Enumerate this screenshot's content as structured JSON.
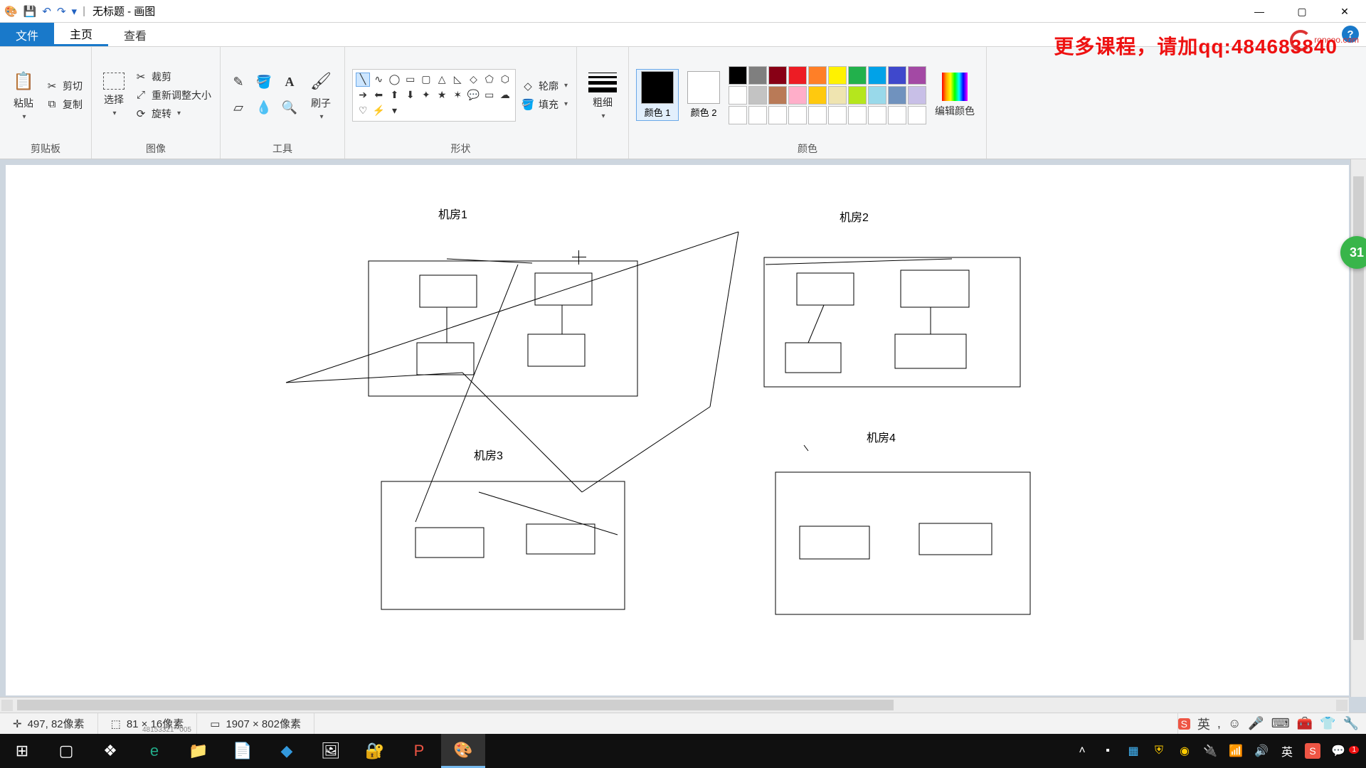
{
  "window": {
    "title": "无标题 - 画图",
    "qat": {
      "save": "💾",
      "undo": "↶",
      "redo": "↷"
    },
    "controls": {
      "min": "—",
      "max": "▢",
      "close": "✕"
    }
  },
  "tabs": {
    "file": "文件",
    "home": "主页",
    "view": "查看"
  },
  "promo": "更多课程，请加qq:484683840",
  "logo_text": "roncoo.com",
  "ribbon": {
    "clipboard": {
      "label": "剪贴板",
      "paste": "粘贴",
      "cut": "剪切",
      "copy": "复制"
    },
    "image": {
      "label": "图像",
      "select": "选择",
      "crop": "裁剪",
      "resize": "重新调整大小",
      "rotate": "旋转"
    },
    "tools": {
      "label": "工具"
    },
    "shapes": {
      "label": "形状",
      "outline": "轮廓",
      "fill": "填充"
    },
    "thickness": {
      "label": "粗细"
    },
    "colors": {
      "label": "颜色",
      "color1": "颜色 1",
      "color2": "颜色 2",
      "edit": "编辑颜色"
    }
  },
  "canvas": {
    "room1": "机房1",
    "room2": "机房2",
    "room3": "机房3",
    "room4": "机房4"
  },
  "status": {
    "cursor_pos": "497, 82像素",
    "selection_size": "81 × 16像素",
    "canvas_size": "1907 × 802像素",
    "tiny": "48153321**005"
  },
  "tray": {
    "ime": "英",
    "badge_right": "1"
  },
  "bubble": "31"
}
